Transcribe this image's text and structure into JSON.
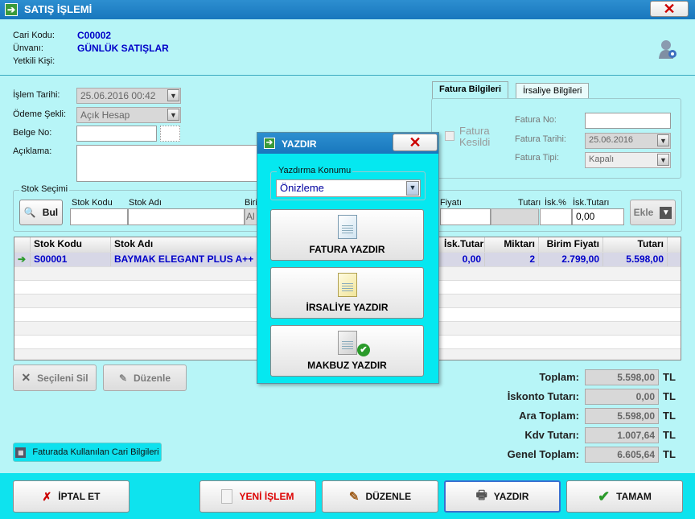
{
  "window": {
    "title": "SATIŞ İŞLEMİ",
    "close_label": "✕"
  },
  "header": {
    "cari_kodu_label": "Cari Kodu:",
    "cari_kodu": "C00002",
    "unvan_label": "Ünvanı:",
    "unvan": "GÜNLÜK SATIŞLAR",
    "yetkili_label": "Yetkili Kişi:"
  },
  "form": {
    "islem_tarihi_label": "İşlem Tarihi:",
    "islem_tarihi": "25.06.2016 00:42",
    "odeme_label": "Ödeme Şekli:",
    "odeme": "Açık Hesap",
    "belge_label": "Belge No:",
    "belge": "",
    "aciklama_label": "Açıklama:",
    "aciklama": ""
  },
  "invoice_tabs": {
    "tab1": "Fatura Bilgileri",
    "tab2": "İrsaliye Bilgileri",
    "fatura_kesildi": "Fatura Kesildi",
    "fatura_no_label": "Fatura No:",
    "fatura_no": "",
    "fatura_tarihi_label": "Fatura Tarihi:",
    "fatura_tarihi": "25.06.2016",
    "fatura_tipi_label": "Fatura Tipi:",
    "fatura_tipi": "Kapalı"
  },
  "stock": {
    "group_label": "Stok Seçimi",
    "bul": "Bul",
    "stok_kodu_label": "Stok Kodu",
    "stok_adi_label": "Stok Adı",
    "birim_label": "Biri",
    "birim_value": "Al",
    "fiyati_label": "Fiyatı",
    "tutari_label": "Tutarı",
    "isk_pct_label": "İsk.%",
    "isk_tutari_label": "İsk.Tutarı",
    "isk_tutari_value": "0,00",
    "ekle": "Ekle"
  },
  "grid": {
    "columns": [
      "Stok Kodu",
      "Stok Adı",
      "İsk.Tutarı",
      "Miktarı",
      "Birim Fiyatı",
      "Tutarı"
    ],
    "rows": [
      {
        "stok_kodu": "S00001",
        "stok_adi": "BAYMAK ELEGANT PLUS A++",
        "isk_tutari": "0,00",
        "miktari": "2",
        "birim_fiyati": "2.799,00",
        "tutari": "5.598,00"
      }
    ]
  },
  "row_actions": {
    "sil": "Seçileni Sil",
    "duzenle": "Düzenle"
  },
  "cari_info_button": "Faturada Kullanılan Cari Bilgileri",
  "totals": {
    "currency": "TL",
    "items": [
      {
        "label": "Toplam:",
        "value": "5.598,00"
      },
      {
        "label": "İskonto Tutarı:",
        "value": "0,00"
      },
      {
        "label": "Ara Toplam:",
        "value": "5.598,00"
      },
      {
        "label": "Kdv Tutarı:",
        "value": "1.007,64"
      },
      {
        "label": "Genel Toplam:",
        "value": "6.605,64"
      }
    ]
  },
  "bottom_buttons": {
    "iptal": "İPTAL ET",
    "yeni": "YENİ İŞLEM",
    "duzenle": "DÜZENLE",
    "yazdir": "YAZDIR",
    "tamam": "TAMAM"
  },
  "dialog": {
    "title": "YAZDIR",
    "konum_label": "Yazdırma Konumu",
    "konum_value": "Önizleme",
    "fatura": "FATURA YAZDIR",
    "irsaliye": "İRSALİYE YAZDIR",
    "makbuz": "MAKBUZ YAZDIR"
  },
  "colors": {
    "background": "#b7f5f7",
    "titlebar": "#1877bd",
    "dialog_bg": "#05e8f0",
    "value_blue": "#0000c8",
    "red_label": "#cc0000"
  }
}
